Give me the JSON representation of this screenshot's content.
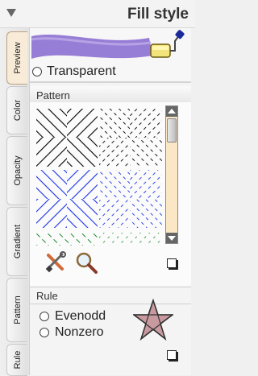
{
  "header": {
    "title": "Fill style",
    "collapse_icon": "triangle-down-icon"
  },
  "tabs": [
    {
      "label": "Preview",
      "active": true
    },
    {
      "label": "Color",
      "active": false
    },
    {
      "label": "Opacity",
      "active": false
    },
    {
      "label": "Gradient",
      "active": false
    },
    {
      "label": "Pattern",
      "active": false
    },
    {
      "label": "Rule",
      "active": false
    }
  ],
  "preview": {
    "stroke_color": "#8b6fd0",
    "transparent_label": "Transparent",
    "transparent_checked": false,
    "icon": "paint-roller-icon"
  },
  "pattern": {
    "header": "Pattern",
    "colors": {
      "black": "#000000",
      "blue": "#1a32e6",
      "green": "#1b8a2a"
    },
    "tools": [
      "tools-icon",
      "magnifier-icon"
    ]
  },
  "rule": {
    "header": "Rule",
    "options": [
      "Evenodd",
      "Nonzero"
    ],
    "selected": null,
    "star_fill": "#c89aa0",
    "icon": "star-icon"
  },
  "accents": {
    "active_tab": "#f8ecd8",
    "scrollbar": "#fbe7c6"
  }
}
